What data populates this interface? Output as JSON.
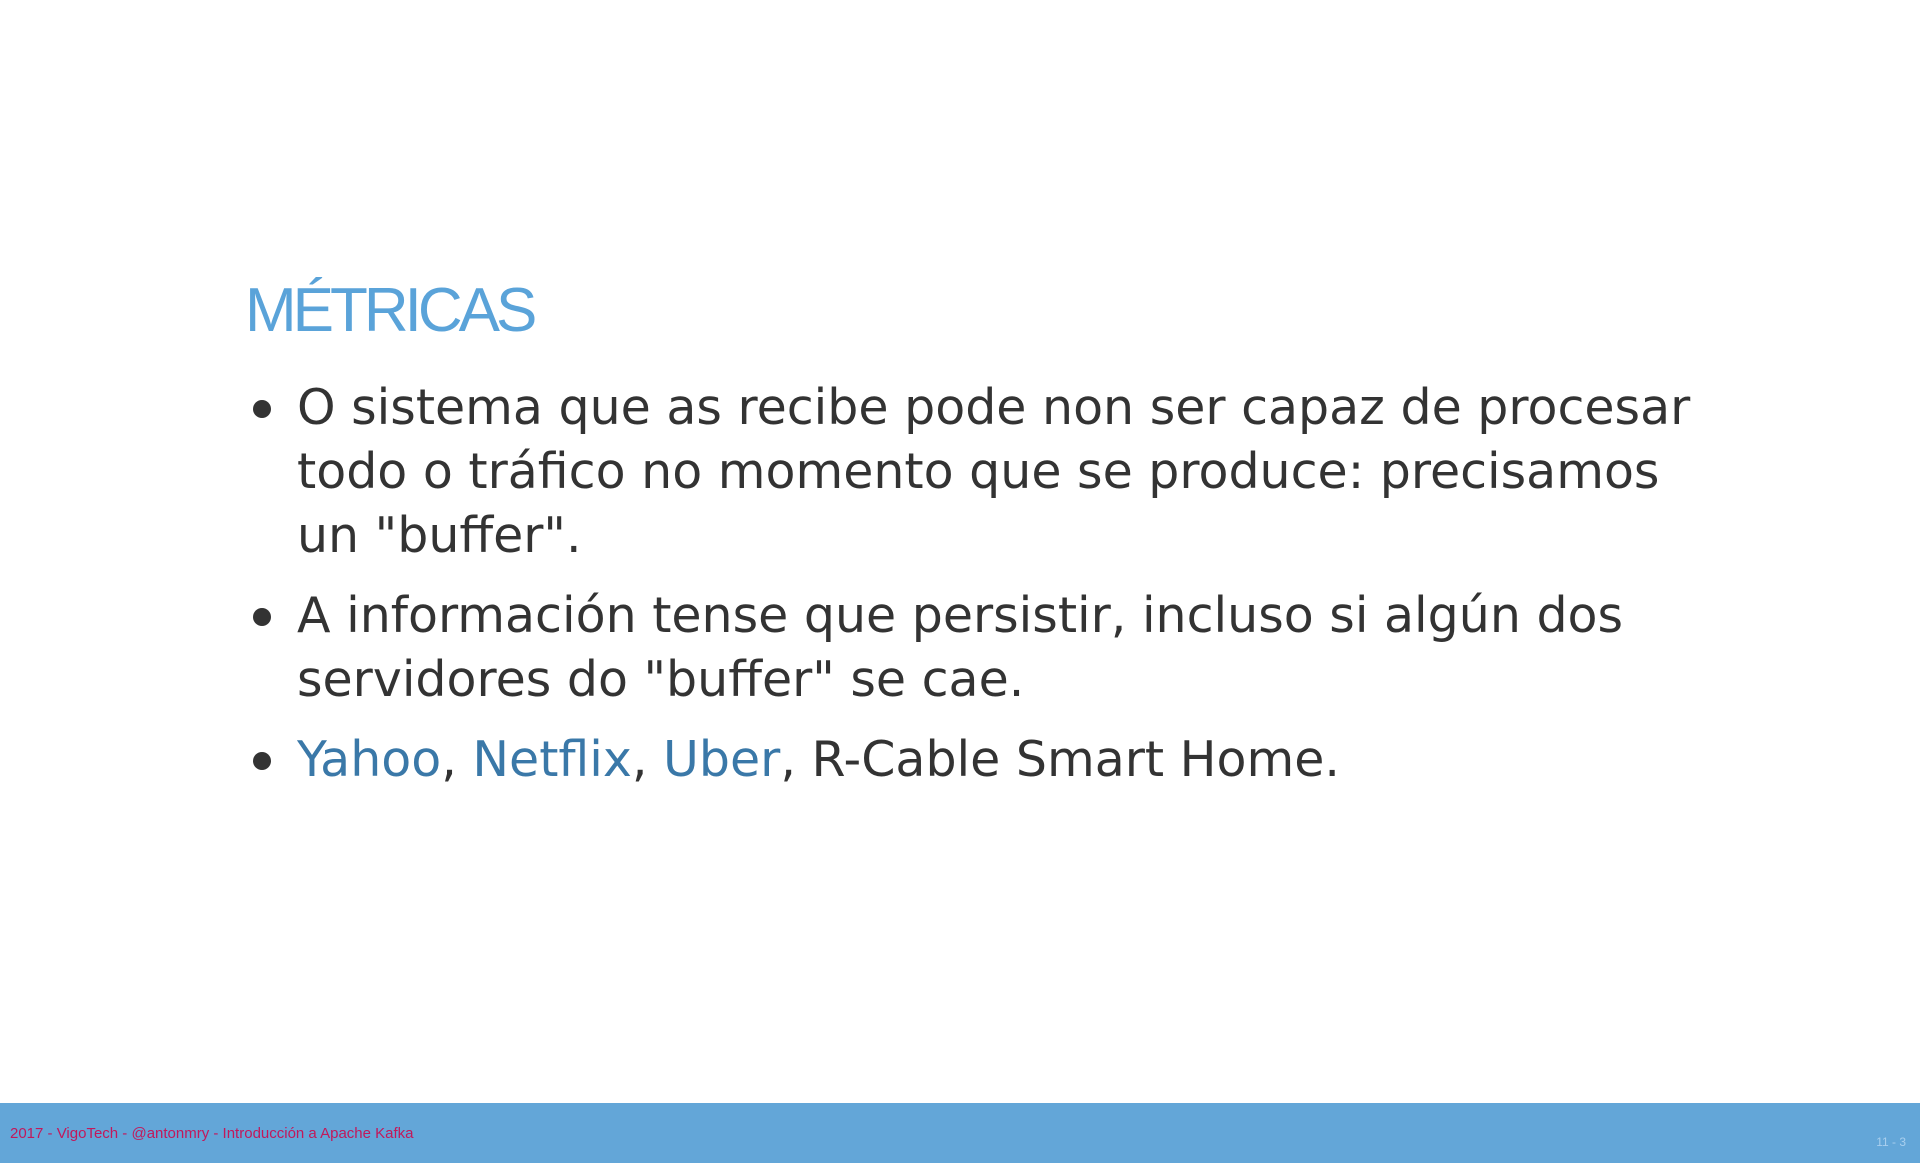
{
  "slide": {
    "title": "MÉTRICAS",
    "bullets": [
      {
        "text": "O sistema que as recibe pode non ser capaz de procesar todo o tráfico no momento que se produce: precisamos un \"buffer\"."
      },
      {
        "text": "A información tense que persistir, incluso si algún dos servidores do \"buffer\" se cae."
      },
      {
        "links": [
          "Yahoo",
          "Netflix",
          "Uber"
        ],
        "separator": ", ",
        "tail": ", R-Cable Smart Home."
      }
    ]
  },
  "footer": {
    "text": "2017 - VigoTech - @antonmry - Introducción a Apache Kafka",
    "slide_number": "11 - 3"
  },
  "colors": {
    "title": "#5aa3d9",
    "body_text": "#333333",
    "link": "#3a78a8",
    "footer_bg": "#63a6d8",
    "footer_text": "#c2185b"
  }
}
